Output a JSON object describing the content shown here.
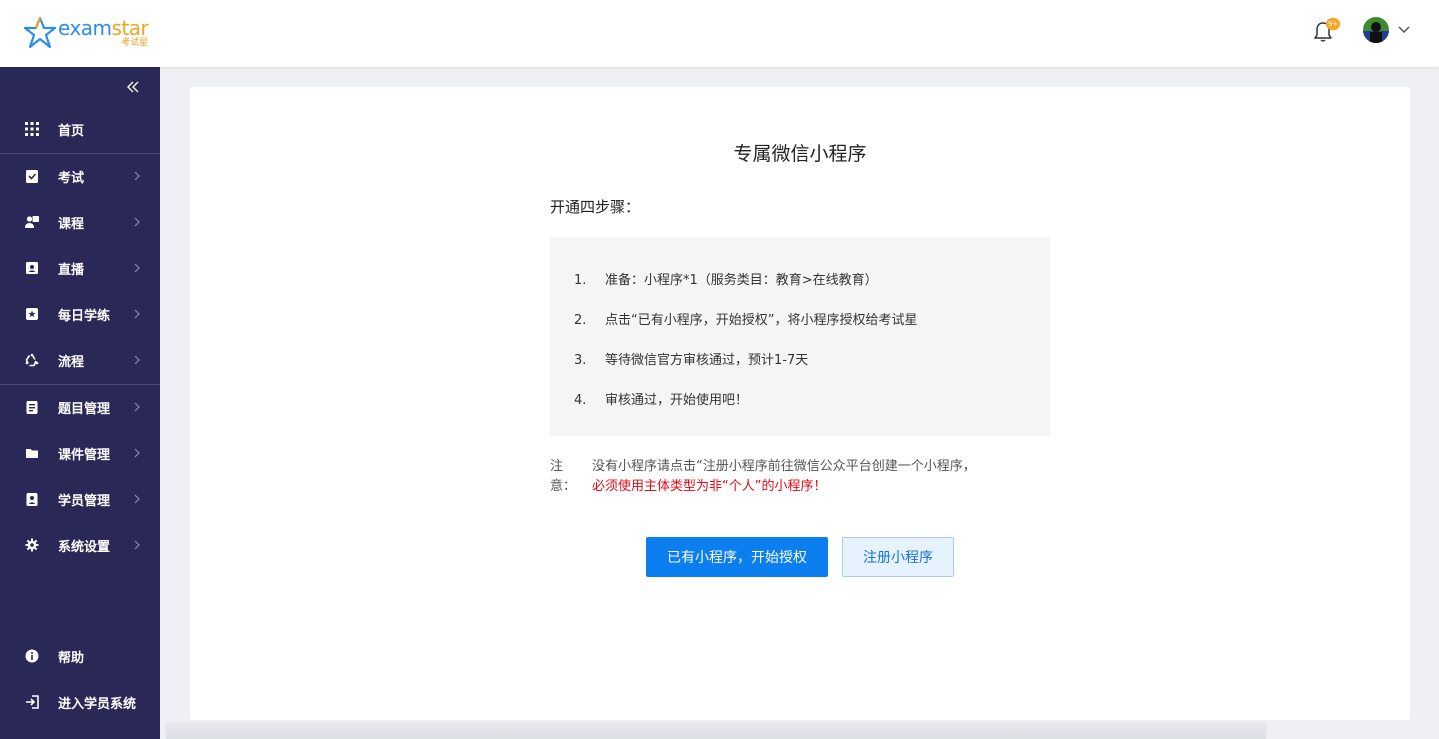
{
  "header": {
    "logo": {
      "brand_a": "exam",
      "brand_b": "star",
      "sub": "考试星"
    },
    "bell_badge": "9+",
    "icons": {
      "bell": "bell-icon",
      "avatar": "avatar",
      "caret": "chevron-down-icon"
    }
  },
  "sidebar": {
    "items": [
      {
        "label": "首页",
        "icon": "grid-icon"
      },
      {
        "label": "考试",
        "icon": "clipboard-check-icon"
      },
      {
        "label": "课程",
        "icon": "teacher-icon"
      },
      {
        "label": "直播",
        "icon": "live-icon"
      },
      {
        "label": "每日学练",
        "icon": "star-box-icon"
      },
      {
        "label": "流程",
        "icon": "recycle-icon"
      },
      {
        "label": "题目管理",
        "icon": "list-doc-icon"
      },
      {
        "label": "课件管理",
        "icon": "folder-icon"
      },
      {
        "label": "学员管理",
        "icon": "id-badge-icon"
      },
      {
        "label": "系统设置",
        "icon": "gear-icon"
      },
      {
        "label": "帮助",
        "icon": "info-icon"
      },
      {
        "label": "进入学员系统",
        "icon": "door-enter-icon"
      }
    ]
  },
  "main": {
    "title": "专属微信小程序",
    "steps_title": "开通四步骤：",
    "steps": [
      {
        "num": "1.",
        "text": "准备：小程序*1（服务类目：教育>在线教育）"
      },
      {
        "num": "2.",
        "text": "点击“已有小程序，开始授权”，将小程序授权给考试星"
      },
      {
        "num": "3.",
        "text": "等待微信官方审核通过，预计1-7天"
      },
      {
        "num": "4.",
        "text": "审核通过，开始使用吧！"
      }
    ],
    "note_label": "注意：",
    "note_text": "没有小程序请点击“注册小程序前往微信公众平台创建一个小程序，",
    "note_warning": "必须使用主体类型为非“个人”的小程序！",
    "primary_button": "已有小程序，开始授权",
    "secondary_button": "注册小程序"
  },
  "colors": {
    "sidebar_bg": "#2a2856",
    "primary": "#0b7ff0",
    "warning": "#e50914",
    "brand_blue": "#2c8ee8",
    "brand_orange": "#f3a321"
  }
}
